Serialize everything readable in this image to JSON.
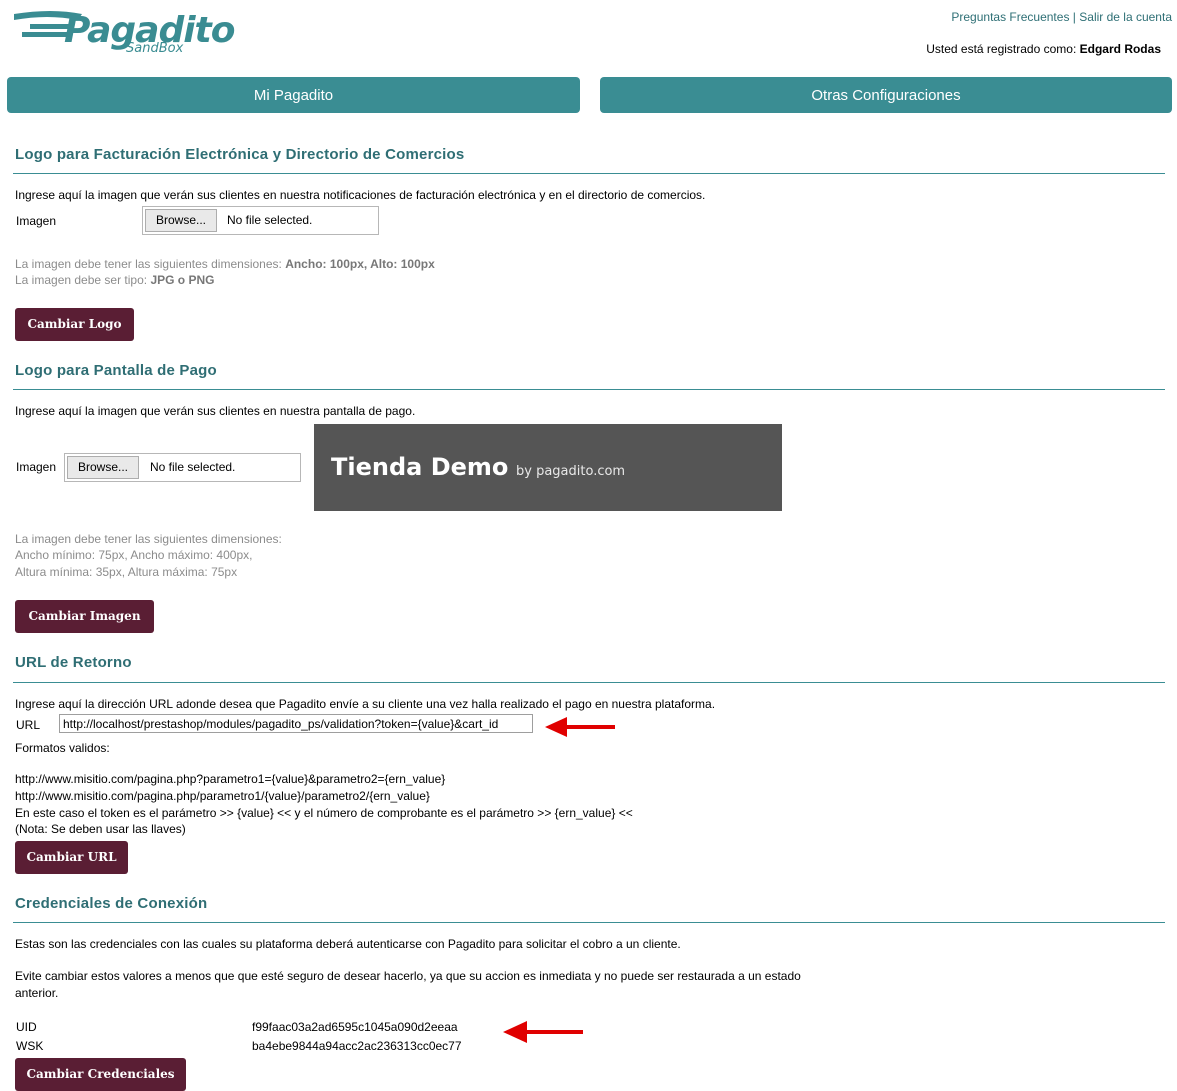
{
  "header": {
    "logo_text": "Pagadito",
    "logo_sub": "SandBox",
    "faq_link": "Preguntas Frecuentes",
    "separator": "|",
    "logout_link": "Salir de la cuenta",
    "registered_label": "Usted está registrado como:",
    "user_name": "Edgard Rodas"
  },
  "tabs": {
    "mi_pagadito": "Mi Pagadito",
    "otras_config": "Otras Configuraciones"
  },
  "logo_facturacion": {
    "title": "Logo para Facturación Electrónica y Directorio de Comercios",
    "description": "Ingrese aquí la imagen que verán sus clientes en nuestra notificaciones de facturación electrónica y en el directorio de comercios.",
    "image_label": "Imagen",
    "browse_label": "Browse...",
    "no_file": "No file selected.",
    "dims_prefix": "La imagen debe tener las siguientes dimensiones:",
    "dims_value": "Ancho: 100px, Alto: 100px",
    "type_prefix": "La imagen debe ser tipo:",
    "type_value": "JPG o PNG",
    "button": "Cambiar Logo"
  },
  "logo_pago": {
    "title": "Logo para Pantalla de Pago",
    "description": "Ingrese aquí la imagen que verán sus clientes en nuestra pantalla de pago.",
    "image_label": "Imagen",
    "browse_label": "Browse...",
    "no_file": "No file selected.",
    "preview_main": "Tienda Demo",
    "preview_by": "by pagadito.com",
    "dims_line1": "La imagen debe tener las siguientes dimensiones:",
    "dims_line2": "Ancho mínimo: 75px, Ancho máximo: 400px,",
    "dims_line3": "Altura mínima: 35px, Altura máxima: 75px",
    "button": "Cambiar Imagen"
  },
  "url_retorno": {
    "title": "URL de Retorno",
    "description": "Ingrese aquí la dirección URL adonde desea que Pagadito envíe a su cliente una vez halla realizado el pago en nuestra plataforma.",
    "url_label": "URL",
    "url_value": "http://localhost/prestashop/modules/pagadito_ps/validation?token={value}&cart_id",
    "formats_label": "Formatos validos:",
    "example1": "http://www.misitio.com/pagina.php?parametro1={value}&parametro2={ern_value}",
    "example2": "http://www.misitio.com/pagina.php/parametro1/{value}/parametro2/{ern_value}",
    "note1": "En este caso el token es el parámetro >> {value} << y el número de comprobante es el parámetro >> {ern_value} <<",
    "note2": "(Nota: Se deben usar las llaves)",
    "button": "Cambiar URL"
  },
  "credenciales": {
    "title": "Credenciales de Conexión",
    "description": "Estas son las credenciales con las cuales su plataforma deberá autenticarse con Pagadito para solicitar el cobro a un cliente.",
    "warning_line1": "Evite cambiar estos valores a menos que que esté seguro de desear hacerlo, ya que su accion es inmediata y no puede ser restaurada a un estado",
    "warning_line2": "anterior.",
    "uid_label": "UID",
    "uid_value": "f99faac03a2ad6595c1045a090d2eeaa",
    "wsk_label": "WSK",
    "wsk_value": "ba4ebe9844a94acc2ac236313cc0ec77",
    "button": "Cambiar Credenciales"
  },
  "colors": {
    "teal": "#3a8d93",
    "button": "#5a1e34",
    "arrow": "#e00000"
  }
}
